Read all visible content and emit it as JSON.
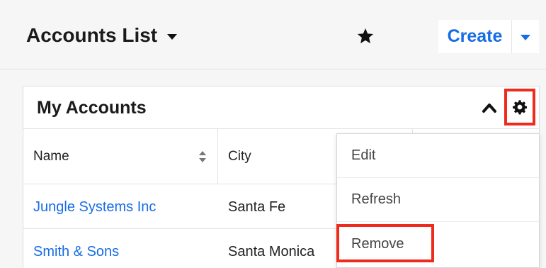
{
  "header": {
    "title": "Accounts List",
    "create_label": "Create"
  },
  "dashlet": {
    "title": "My Accounts",
    "columns": [
      "Name",
      "City"
    ],
    "rows": [
      {
        "name": "Jungle Systems Inc",
        "city": "Santa Fe"
      },
      {
        "name": "Smith & Sons",
        "city": "Santa Monica"
      }
    ]
  },
  "menu": {
    "items": [
      "Edit",
      "Refresh",
      "Remove"
    ]
  },
  "colors": {
    "link": "#176de5",
    "highlight": "#ef2b1e"
  },
  "icons": [
    "chevron-down-icon",
    "star-icon",
    "chevron-up-icon",
    "gear-icon",
    "sort-icon"
  ]
}
